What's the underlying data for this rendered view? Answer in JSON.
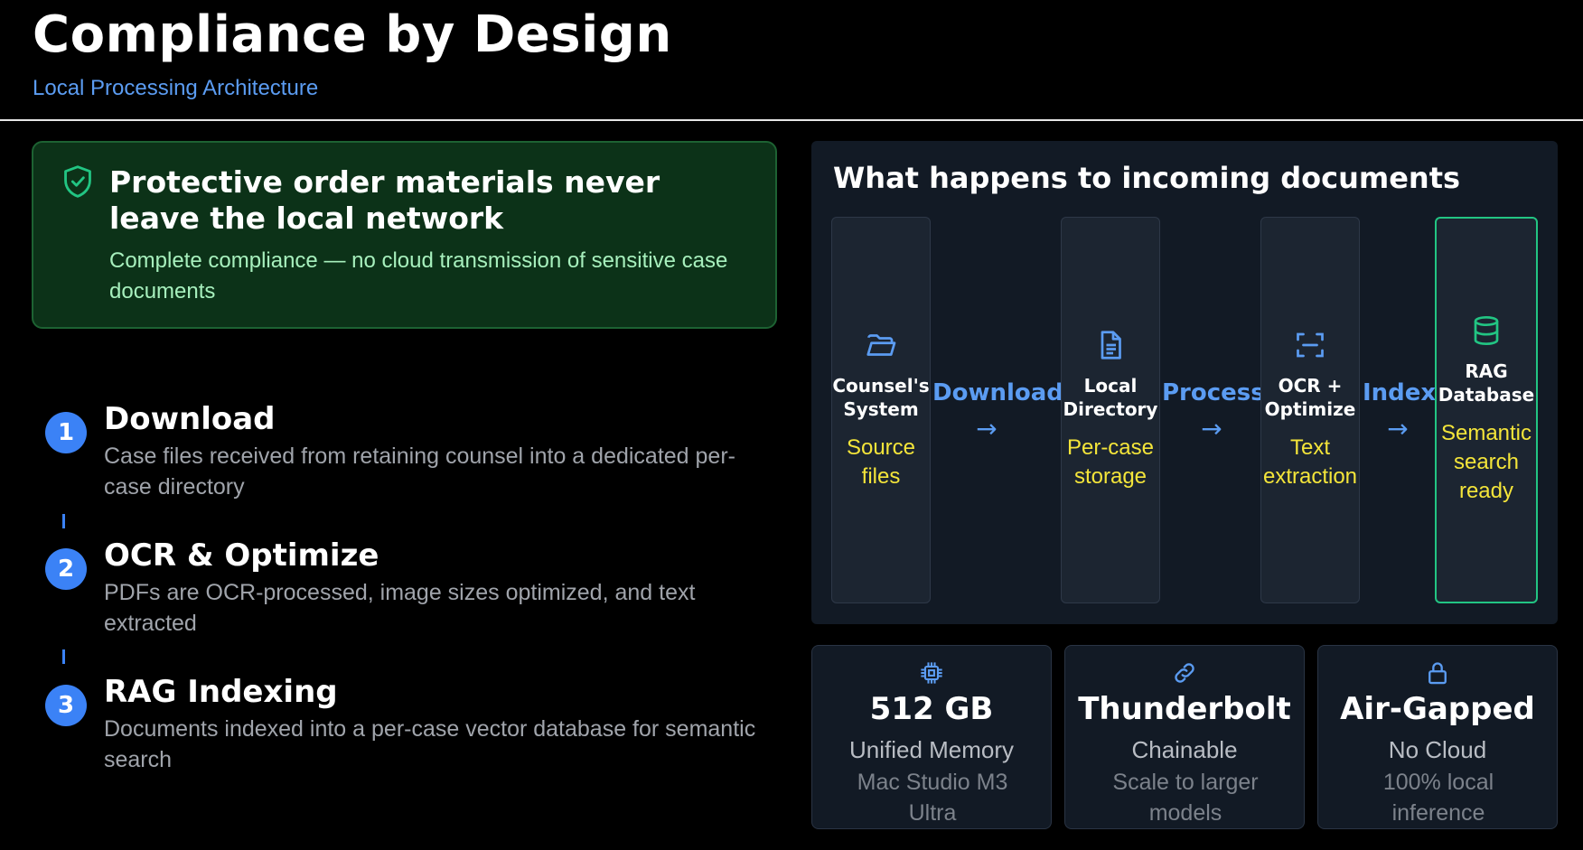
{
  "header": {
    "title": "Compliance by Design",
    "subtitle": "Local Processing Architecture"
  },
  "callout": {
    "icon": "shield-check-icon",
    "heading": "Protective order materials never leave the local network",
    "body": "Complete compliance — no cloud transmission of sensitive case documents"
  },
  "steps": [
    {
      "number": "1",
      "title": "Download",
      "description": "Case files received from retaining counsel into a dedicated per-case directory"
    },
    {
      "number": "2",
      "title": "OCR & Optimize",
      "description": "PDFs are OCR-processed, image sizes optimized, and text extracted"
    },
    {
      "number": "3",
      "title": "RAG Indexing",
      "description": "Documents indexed into a per-case vector database for semantic search"
    }
  ],
  "flow": {
    "heading": "What happens to incoming documents",
    "stages": [
      {
        "icon": "folder-icon",
        "name": "Counsel's System",
        "description": "Source files"
      },
      {
        "icon": "document-icon",
        "name": "Local Directory",
        "description": "Per-case storage"
      },
      {
        "icon": "scan-text-icon",
        "name": "OCR + Optimize",
        "description": "Text extraction"
      },
      {
        "icon": "database-icon",
        "name": "RAG Database",
        "description": "Semantic search ready"
      }
    ],
    "arrows": [
      {
        "label": "Download",
        "glyph": "→"
      },
      {
        "label": "Process",
        "glyph": "→"
      },
      {
        "label": "Index",
        "glyph": "→"
      }
    ]
  },
  "cards": [
    {
      "icon": "cpu-chip-icon",
      "value": "512 GB",
      "label": "Unified Memory",
      "detail": "Mac Studio M3 Ultra"
    },
    {
      "icon": "link-icon",
      "value": "Thunderbolt",
      "label": "Chainable",
      "detail": "Scale to larger models"
    },
    {
      "icon": "lock-icon",
      "value": "Air-Gapped",
      "label": "No Cloud",
      "detail": "100% local inference"
    }
  ],
  "colors": {
    "accent_blue": "#3b82f6",
    "callout_green": "#0c3218",
    "stage_yellow": "#f4e53a",
    "active_border": "#22c583"
  }
}
